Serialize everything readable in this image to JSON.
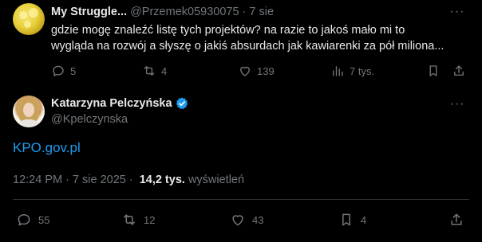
{
  "reply": {
    "name": "My Struggle...",
    "handle": "@Przemek05930075",
    "dot": "·",
    "time": "7 sie",
    "more": "···",
    "text_line1": "gdzie mogę znaleźć listę tych projektów? na razie to jakoś mało mi to",
    "text_line2": "wygląda na rozwój a słyszę o jakiś absurdach jak kawiarenki za pół miliona...",
    "stats": {
      "replies": "5",
      "reposts": "4",
      "likes": "139",
      "views": "7 tys."
    }
  },
  "main": {
    "name": "Katarzyna Pelczyńska",
    "handle": "@Kpelczynska",
    "more": "···",
    "link": "KPO.gov.pl",
    "time": "12:24 PM",
    "dot": "·",
    "date": "7 sie 2025",
    "dot2": "·",
    "views_count": "14,2 tys.",
    "views_label": "wyświetleń",
    "stats": {
      "replies": "55",
      "reposts": "12",
      "likes": "43",
      "bookmarks": "4"
    }
  },
  "colors": {
    "background": "#000000",
    "text": "#e7e9ea",
    "muted": "#71767b",
    "link": "#1d9bf0",
    "verified": "#1d9bf0",
    "divider": "#2f3336"
  },
  "icons": [
    "reply-icon",
    "repost-icon",
    "like-icon",
    "views-icon",
    "bookmark-icon",
    "share-icon",
    "verified-badge-icon",
    "more-icon"
  ]
}
